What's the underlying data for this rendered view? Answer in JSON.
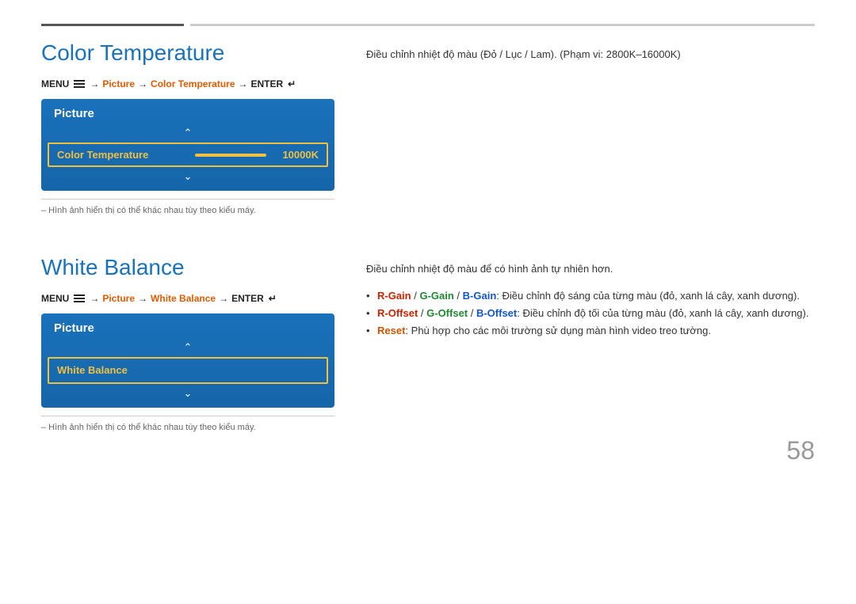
{
  "page": {
    "number": "58"
  },
  "section1": {
    "title": "Color Temperature",
    "menu_path": {
      "menu": "MENU",
      "arrow1": "→",
      "picture": "Picture",
      "arrow2": "→",
      "highlight": "Color Temperature",
      "arrow3": "→",
      "enter": "ENTER"
    },
    "picture_box": {
      "header": "Picture",
      "item_label": "Color Temperature",
      "item_value": "10000K"
    },
    "image_note": "– Hình ảnh hiển thị có thể khác nhau tùy theo kiểu máy.",
    "description": "Điều chỉnh nhiệt độ màu (Đỏ / Lục / Lam). (Phạm vi: 2800K–16000K)"
  },
  "section2": {
    "title": "White Balance",
    "menu_path": {
      "menu": "MENU",
      "arrow1": "→",
      "picture": "Picture",
      "arrow2": "→",
      "highlight": "White Balance",
      "arrow3": "→",
      "enter": "ENTER"
    },
    "picture_box": {
      "header": "Picture",
      "item_label": "White Balance"
    },
    "image_note": "– Hình ảnh hiển thị có thể khác nhau tùy theo kiểu máy.",
    "description": "Điều chỉnh nhiệt độ màu để có hình ảnh tự nhiên hơn.",
    "bullets": [
      {
        "red": "R-Gain",
        "sep1": " / ",
        "green": "G-Gain",
        "sep2": " / ",
        "blue": "B-Gain",
        "rest": ": Điều chỉnh độ sáng của từng màu (đỏ, xanh lá cây, xanh dương)."
      },
      {
        "red": "R-Offset",
        "sep1": " / ",
        "green": "G-Offset",
        "sep2": " / ",
        "blue": "B-Offset",
        "rest": ": Điều chỉnh độ tối của từng màu (đỏ, xanh lá cây, xanh dương)."
      },
      {
        "orange": "Reset",
        "rest": ": Phù hợp cho các môi trường sử dụng màn hình video treo tường."
      }
    ]
  }
}
